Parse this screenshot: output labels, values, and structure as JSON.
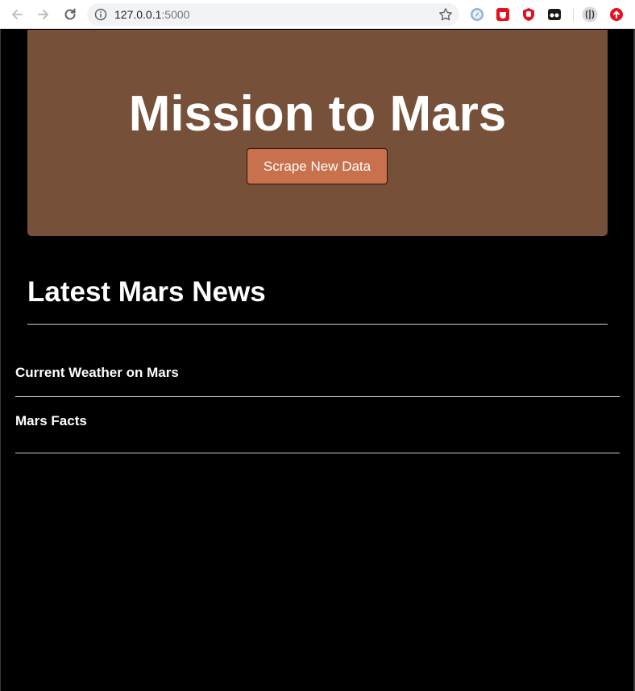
{
  "browser": {
    "url_host": "127.0.0.1",
    "url_port": ":5000"
  },
  "jumbotron": {
    "title": "Mission to Mars",
    "scrape_button_label": "Scrape New Data"
  },
  "news": {
    "heading": "Latest Mars News"
  },
  "sections": {
    "weather_heading": "Current Weather on Mars",
    "facts_heading": "Mars Facts"
  },
  "colors": {
    "page_background": "#000000",
    "jumbotron_background": "#765039",
    "button_background": "#c9704d",
    "text": "#ffffff"
  },
  "icons": {
    "back": "arrow-left-icon",
    "forward": "arrow-right-icon",
    "reload": "reload-icon",
    "site_info": "info-icon",
    "bookmark": "star-icon"
  }
}
